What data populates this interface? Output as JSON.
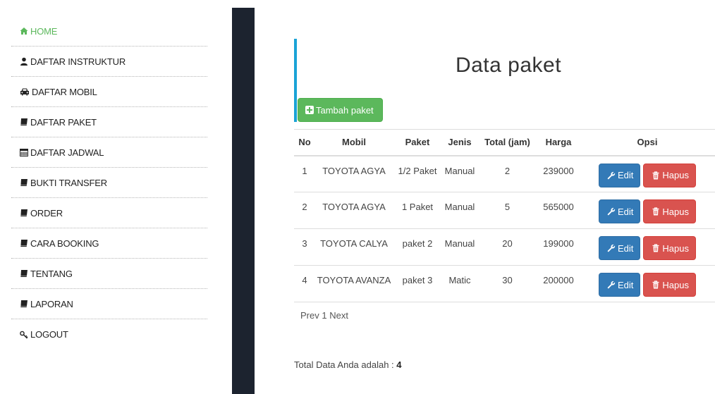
{
  "sidebar": {
    "items": [
      {
        "label": "HOME",
        "icon": "home-icon",
        "active": true
      },
      {
        "label": "DAFTAR INSTRUKTUR",
        "icon": "user-icon"
      },
      {
        "label": "DAFTAR MOBIL",
        "icon": "car-icon"
      },
      {
        "label": "DAFTAR PAKET",
        "icon": "book-icon"
      },
      {
        "label": "DAFTAR JADWAL",
        "icon": "calendar-icon"
      },
      {
        "label": "BUKTI TRANSFER",
        "icon": "book-icon"
      },
      {
        "label": "ORDER",
        "icon": "book-icon"
      },
      {
        "label": "CARA BOOKING",
        "icon": "book-icon"
      },
      {
        "label": "TENTANG",
        "icon": "book-icon"
      },
      {
        "label": "LAPORAN",
        "icon": "book-icon"
      },
      {
        "label": "LOGOUT",
        "icon": "key-icon"
      }
    ]
  },
  "main": {
    "title": "Data paket",
    "add_button": "Tambah paket",
    "columns": [
      "No",
      "Mobil",
      "Paket",
      "Jenis",
      "Total (jam)",
      "Harga",
      "Opsi"
    ],
    "rows": [
      {
        "no": "1",
        "mobil": "TOYOTA AGYA",
        "paket": "1/2 Paket",
        "jenis": "Manual",
        "total": "2",
        "harga": "239000"
      },
      {
        "no": "2",
        "mobil": "TOYOTA AGYA",
        "paket": "1 Paket",
        "jenis": "Manual",
        "total": "5",
        "harga": "565000"
      },
      {
        "no": "3",
        "mobil": "TOYOTA CALYA",
        "paket": "paket 2",
        "jenis": "Manual",
        "total": "20",
        "harga": "199000"
      },
      {
        "no": "4",
        "mobil": "TOYOTA AVANZA",
        "paket": "paket 3",
        "jenis": "Matic",
        "total": "30",
        "harga": "200000"
      }
    ],
    "edit_label": "Edit",
    "delete_label": "Hapus",
    "pager": {
      "prev": "Prev",
      "page": "1",
      "next": "Next"
    },
    "total_label": "Total Data Anda adalah :",
    "total_value": "4"
  },
  "colors": {
    "accent": "#1aa3d6",
    "success": "#5cb85c",
    "primary": "#337ab7",
    "danger": "#d9534f",
    "divider": "#1c232f"
  }
}
